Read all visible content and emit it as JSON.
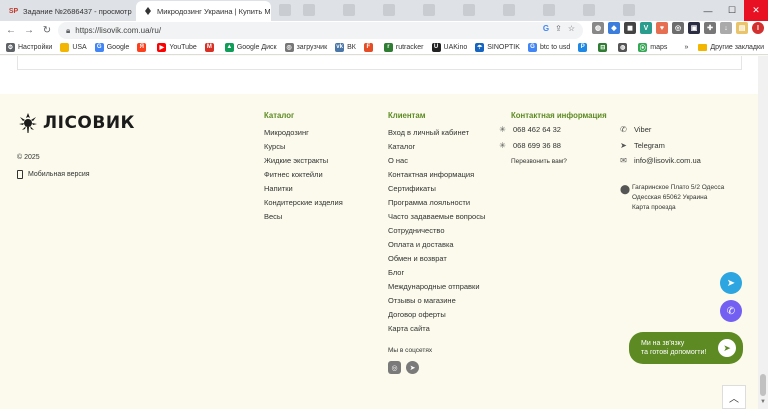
{
  "browser": {
    "tabs": [
      {
        "icon_text": "SP",
        "title": "Задание №2686437 - просмотр з",
        "close": "✕"
      },
      {
        "icon_text": "",
        "title": "Микродозинг Украина | Купить М",
        "close": "✕"
      }
    ],
    "url": "https://lisovik.com.ua/ru/",
    "window_controls": {
      "minimize": "—",
      "maximize": "☐",
      "close": "✕"
    }
  },
  "bookmarks": [
    {
      "label": "Настройки",
      "icon": "gear-icon",
      "color": "#5f6368",
      "glyph": "⚙"
    },
    {
      "label": "USA",
      "icon": "folder-icon",
      "color": "#f2b600",
      "glyph": ""
    },
    {
      "label": "Google",
      "icon": "google-icon",
      "color": "#4285f4",
      "glyph": "G"
    },
    {
      "label": "",
      "icon": "yandex-icon",
      "color": "#fc3f1d",
      "glyph": "Я"
    },
    {
      "label": "YouTube",
      "icon": "youtube-icon",
      "color": "#ff0000",
      "glyph": "▶"
    },
    {
      "label": "",
      "icon": "gmail-icon",
      "color": "#d93025",
      "glyph": "M"
    },
    {
      "label": "Google Диск",
      "icon": "drive-icon",
      "color": "#0f9d58",
      "glyph": "▲"
    },
    {
      "label": "загрузчик",
      "icon": "globe-icon",
      "color": "#777777",
      "glyph": "◎"
    },
    {
      "label": "ВК",
      "icon": "vk-icon",
      "color": "#4a76a8",
      "glyph": "vk"
    },
    {
      "label": "",
      "icon": "bookmark-red-icon",
      "color": "#e44d26",
      "glyph": "F"
    },
    {
      "label": "rutracker",
      "icon": "rutracker-icon",
      "color": "#2e7d32",
      "glyph": "r"
    },
    {
      "label": "UAKino",
      "icon": "uakino-icon",
      "color": "#222222",
      "glyph": "U"
    },
    {
      "label": "SINOPTIK",
      "icon": "sinoptik-icon",
      "color": "#1565c0",
      "glyph": "☂"
    },
    {
      "label": "btc to usd",
      "icon": "google-icon",
      "color": "#4285f4",
      "glyph": "G"
    },
    {
      "label": "",
      "icon": "bookmark-blue-icon",
      "color": "#1e88e5",
      "glyph": "P"
    },
    {
      "label": "",
      "icon": "bookmark-green-icon",
      "color": "#2e7d32",
      "glyph": "⊟"
    },
    {
      "label": "",
      "icon": "bookmark-gray-icon",
      "color": "#555555",
      "glyph": "◍"
    },
    {
      "label": "maps",
      "icon": "maps-icon",
      "color": "#34a853",
      "glyph": "⦿"
    }
  ],
  "bookmarks_more": "»",
  "other_bookmarks": "Другие закладки",
  "footer": {
    "logo_text": "ЛІСОВИК",
    "copyright": "© 2025",
    "mobile_version": "Мобильная версия",
    "catalog": {
      "title": "Каталог",
      "links": [
        "Микродозинг",
        "Курсы",
        "Жидкие экстракты",
        "Фитнес коктейли",
        "Напитки",
        "Кондитерские изделия",
        "Весы"
      ]
    },
    "clients": {
      "title": "Клиентам",
      "links": [
        "Вход в личный кабинет",
        "Каталог",
        "О нас",
        "Контактная информация",
        "Сертификаты",
        "Программа лояльности",
        "Часто задаваемые вопросы",
        "Сотрудничество",
        "Оплата и доставка",
        "Обмен и возврат",
        "Блог",
        "Международные отправки",
        "Отзывы о магазине",
        "Договор оферты",
        "Карта сайта"
      ]
    },
    "contacts": {
      "title": "Контактная информация",
      "phone1": "068 462 64 32",
      "phone2": "068 699 36 88",
      "callback": "Перезвонить вам?",
      "viber": "Viber",
      "telegram": "Telegram",
      "email": "info@lisovik.com.ua",
      "address_line1": "Гагаринское Плато 5/2 Одесса",
      "address_line2": "Одесская 65062 Украина",
      "map_link": "Карта проезда"
    },
    "social_title": "Мы в соцсетях"
  },
  "chat_widget": {
    "line1": "Ми на зв'язку",
    "line2": "та готові допомогти!"
  },
  "colors": {
    "accent": "#5d8a22",
    "footer_bg": "#fbfaec",
    "telegram": "#2ca5e0",
    "viber": "#7360f2"
  }
}
